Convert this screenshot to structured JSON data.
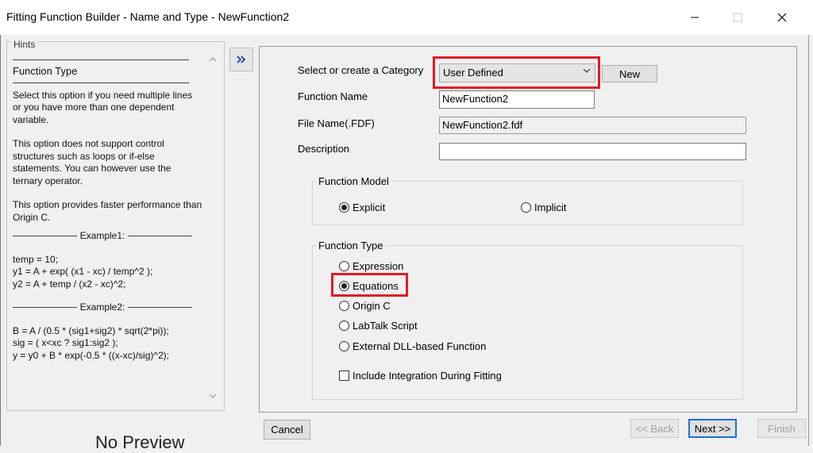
{
  "window": {
    "title": "Fitting Function Builder - Name and Type - NewFunction2"
  },
  "hints": {
    "legend": "Hints",
    "heading": "Function Type",
    "paragraphs": [
      "Select this option if you need multiple lines or you have more than one dependent variable.",
      "This option does not support control structures such as loops or if-else statements. You can however use the ternary operator.",
      "This option provides faster performance than Origin C."
    ],
    "example1_label": "Example1:",
    "example1_lines": [
      "temp = 10;",
      "y1 = A + exp( (x1 - xc) / temp^2 );",
      "y2 = A + temp / (x2 - xc)^2;"
    ],
    "example2_label": "Example2:",
    "example2_lines": [
      "B = A / (0.5 * (sig1+sig2) * sqrt(2*pi));",
      "sig = ( x<xc ? sig1:sig2 );",
      "y = y0 + B * exp(-0.5 * ((x-xc)/sig)^2);"
    ]
  },
  "form": {
    "category_label": "Select or create a Category",
    "category_value": "User Defined",
    "new_button": "New",
    "function_name_label": "Function Name",
    "function_name_value": "NewFunction2",
    "file_name_label": "File Name(.FDF)",
    "file_name_value": "NewFunction2.fdf",
    "description_label": "Description",
    "description_value": ""
  },
  "function_model": {
    "legend": "Function Model",
    "options": [
      {
        "label": "Explicit",
        "selected": true
      },
      {
        "label": "Implicit",
        "selected": false
      }
    ]
  },
  "function_type": {
    "legend": "Function Type",
    "options": [
      {
        "label": "Expression",
        "selected": false
      },
      {
        "label": "Equations",
        "selected": true
      },
      {
        "label": "Origin C",
        "selected": false
      },
      {
        "label": "LabTalk Script",
        "selected": false
      },
      {
        "label": "External DLL-based Function",
        "selected": false
      }
    ],
    "include_integration_label": "Include Integration During Fitting",
    "include_integration_checked": false
  },
  "footer": {
    "cancel": "Cancel",
    "back": "<< Back",
    "next": "Next >>",
    "finish": "Finish"
  },
  "background": {
    "no_preview": "No Preview"
  },
  "colors": {
    "highlight": "#e01b24",
    "default_button_border": "#1c6fd6"
  }
}
